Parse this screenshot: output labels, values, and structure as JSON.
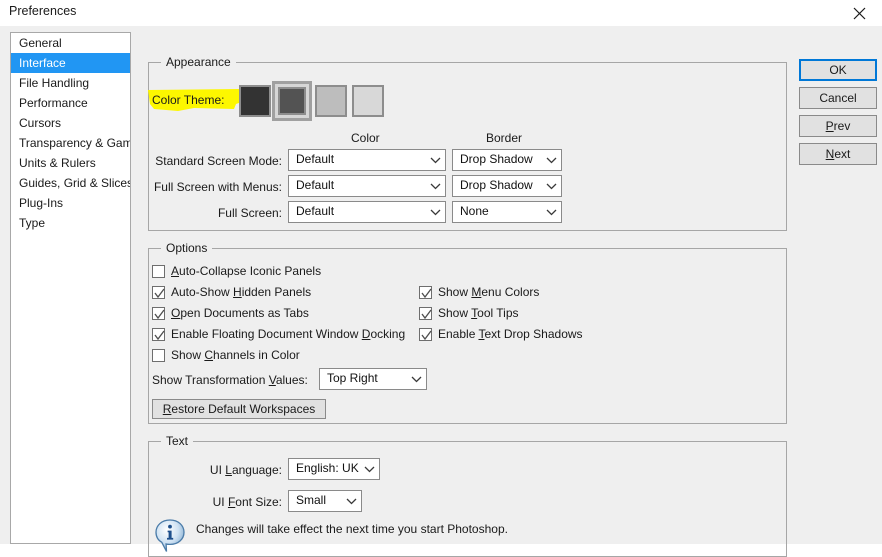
{
  "window": {
    "title": "Preferences",
    "close_icon": "close-icon"
  },
  "sidebar": {
    "items": [
      {
        "label": "General",
        "selected": false
      },
      {
        "label": "Interface",
        "selected": true
      },
      {
        "label": "File Handling",
        "selected": false
      },
      {
        "label": "Performance",
        "selected": false
      },
      {
        "label": "Cursors",
        "selected": false
      },
      {
        "label": "Transparency & Gamut",
        "selected": false
      },
      {
        "label": "Units & Rulers",
        "selected": false
      },
      {
        "label": "Guides, Grid & Slices",
        "selected": false
      },
      {
        "label": "Plug-Ins",
        "selected": false
      },
      {
        "label": "Type",
        "selected": false
      }
    ]
  },
  "buttons": {
    "ok": "OK",
    "cancel": "Cancel",
    "prev": "Prev",
    "next": "Next"
  },
  "appearance": {
    "legend": "Appearance",
    "color_theme_label": "Color Theme:",
    "highlight_color": "#fdf700",
    "swatches": [
      {
        "name": "theme-darkest",
        "color": "#333333",
        "selected": false
      },
      {
        "name": "theme-dark",
        "color": "#535353",
        "selected": true
      },
      {
        "name": "theme-medium",
        "color": "#bdbdbd",
        "selected": false
      },
      {
        "name": "theme-light",
        "color": "#d8d8d8",
        "selected": false
      }
    ],
    "col_color": "Color",
    "col_border": "Border",
    "rows": [
      {
        "label": "Standard Screen Mode:",
        "color": "Default",
        "border": "Drop Shadow"
      },
      {
        "label": "Full Screen with Menus:",
        "color": "Default",
        "border": "Drop Shadow"
      },
      {
        "label": "Full Screen:",
        "color": "Default",
        "border": "None"
      }
    ]
  },
  "options": {
    "legend": "Options",
    "left_checks": [
      {
        "label": "Auto-Collapse Iconic Panels",
        "pre": "A",
        "post": "uto-Collapse Iconic Panels",
        "checked": false
      },
      {
        "label": "Auto-Show Hidden Panels",
        "pre": "Auto-Show ",
        "acc": "H",
        "post": "idden Panels",
        "checked": true
      },
      {
        "label": "Open Documents as Tabs",
        "pre": "",
        "acc": "O",
        "post": "pen Documents as Tabs",
        "checked": true
      },
      {
        "label": "Enable Floating Document Window Docking",
        "pre": "Enable Floating Document Window ",
        "acc": "D",
        "post": "ocking",
        "checked": true
      },
      {
        "label": "Show Channels in Color",
        "pre": "Show ",
        "acc": "C",
        "post": "hannels in Color",
        "checked": false
      }
    ],
    "right_checks": [
      {
        "label": "Show Menu Colors",
        "pre": "Show ",
        "acc": "M",
        "post": "enu Colors",
        "checked": true
      },
      {
        "label": "Show Tool Tips",
        "pre": "Show ",
        "acc": "T",
        "post": "ool Tips",
        "checked": true
      },
      {
        "label": "Enable Text Drop Shadows",
        "pre": "Enable ",
        "acc": "T",
        "post": "ext Drop Shadows",
        "checked": true
      }
    ],
    "transform_label": "Show Transformation Values:",
    "transform_value": "Top Right",
    "restore_button": "Restore Default Workspaces"
  },
  "text_section": {
    "legend": "Text",
    "ui_language_label": "UI Language:",
    "ui_language_value": "English: UK",
    "ui_font_size_label": "UI Font Size:",
    "ui_font_size_value": "Small",
    "note": "Changes will take effect the next time you start Photoshop.",
    "note_icon": "info-icon"
  }
}
